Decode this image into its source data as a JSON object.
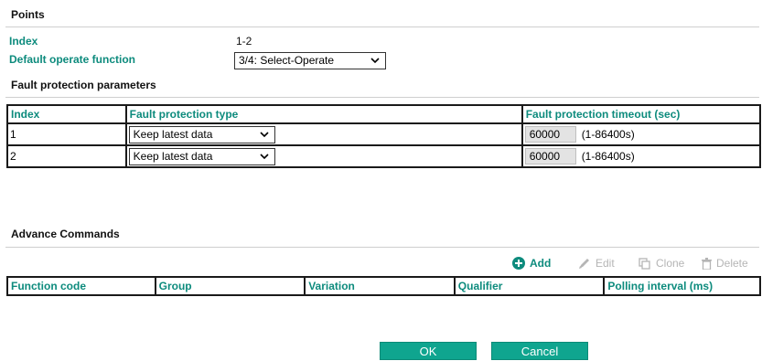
{
  "points": {
    "title": "Points",
    "index_label": "Index",
    "index_value": "1-2",
    "default_operate_label": "Default operate function",
    "default_operate_value": "3/4: Select-Operate"
  },
  "fault": {
    "title": "Fault protection parameters",
    "columns": [
      "Index",
      "Fault protection type",
      "Fault protection timeout (sec)"
    ],
    "rows": [
      {
        "index": "1",
        "type": "Keep latest data",
        "timeout": "60000",
        "range": "(1-86400s)"
      },
      {
        "index": "2",
        "type": "Keep latest data",
        "timeout": "60000",
        "range": "(1-86400s)"
      }
    ]
  },
  "advance": {
    "title": "Advance Commands",
    "toolbar": {
      "add": "Add",
      "edit": "Edit",
      "clone": "Clone",
      "delete": "Delete"
    },
    "columns": [
      "Function code",
      "Group",
      "Variation",
      "Qualifier",
      "Polling interval (ms)"
    ]
  },
  "buttons": {
    "ok": "OK",
    "cancel": "Cancel"
  },
  "colors": {
    "accent": "#0d8b7d",
    "button": "#0fa58f",
    "disabled": "#b5b5b5"
  }
}
